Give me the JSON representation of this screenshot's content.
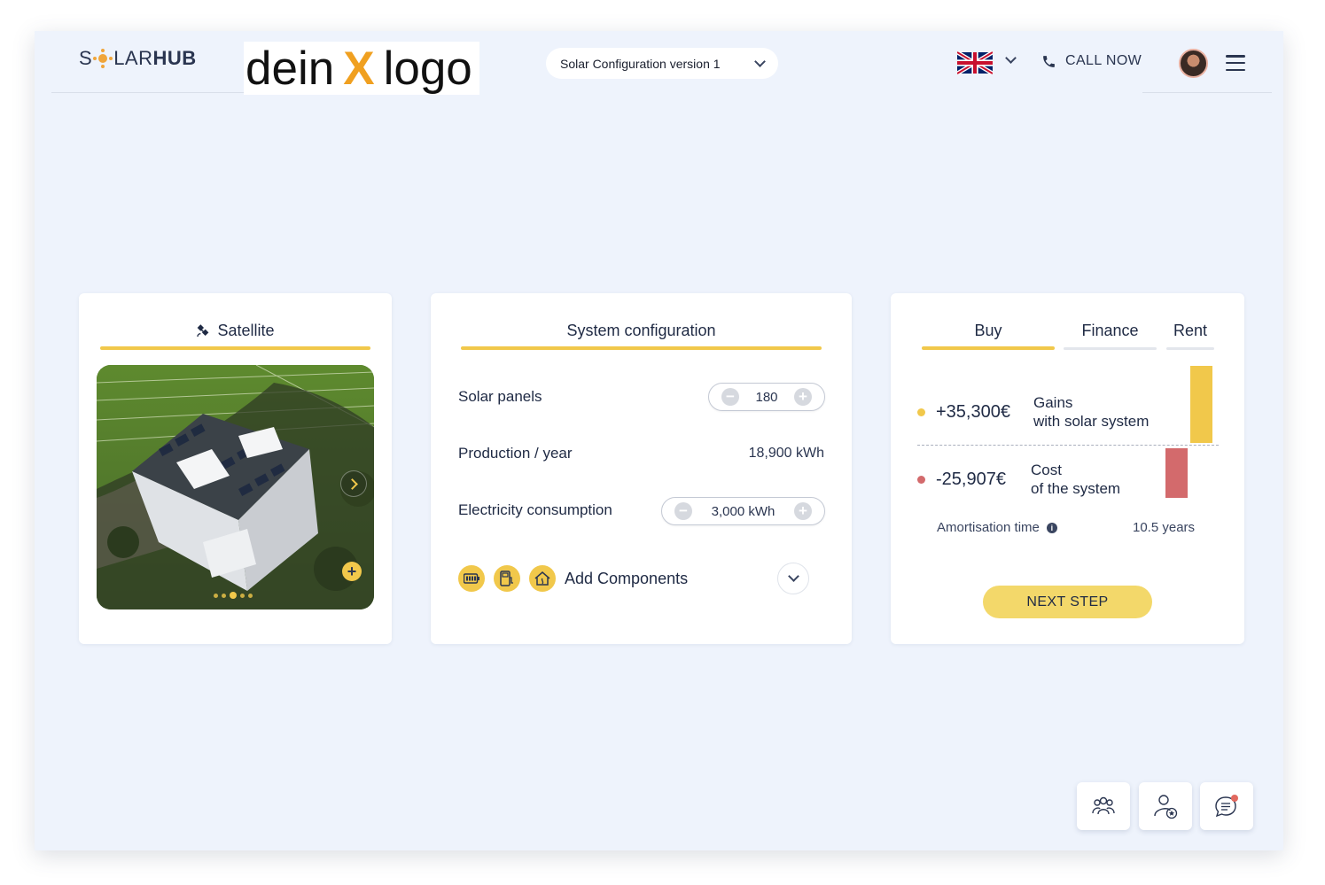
{
  "header": {
    "brand_left": "S",
    "brand_mid": "LAR",
    "brand_hub": "HUB",
    "logo_left": "dein",
    "logo_x": "X",
    "logo_right": "logo",
    "config_select": "Solar Configuration version 1",
    "call_label": "CALL NOW"
  },
  "satellite": {
    "tab_label": "Satellite"
  },
  "system": {
    "tab_label": "System configuration",
    "solar_panels_label": "Solar panels",
    "solar_panels_value": "180",
    "production_label": "Production / year",
    "production_value": "18,900 kWh",
    "consumption_label": "Electricity consumption",
    "consumption_value": "3,000 kWh",
    "add_components_label": "Add Components"
  },
  "pricing": {
    "tabs": [
      {
        "label": "Buy",
        "active": true
      },
      {
        "label": "Finance",
        "active": false
      },
      {
        "label": "Rent",
        "active": false
      }
    ],
    "gains_amount": "+35,300€",
    "gains_line1": "Gains",
    "gains_line2": "with solar system",
    "cost_amount": "-25,907€",
    "cost_line1": "Cost",
    "cost_line2": "of the system",
    "amortisation_label": "Amortisation time",
    "amortisation_value": "10.5 years",
    "next_step_label": "NEXT STEP"
  },
  "colors": {
    "accent": "#f1c84b",
    "gain": "#f1c84b",
    "cost": "#d36a6c",
    "background": "#eef3fc"
  }
}
